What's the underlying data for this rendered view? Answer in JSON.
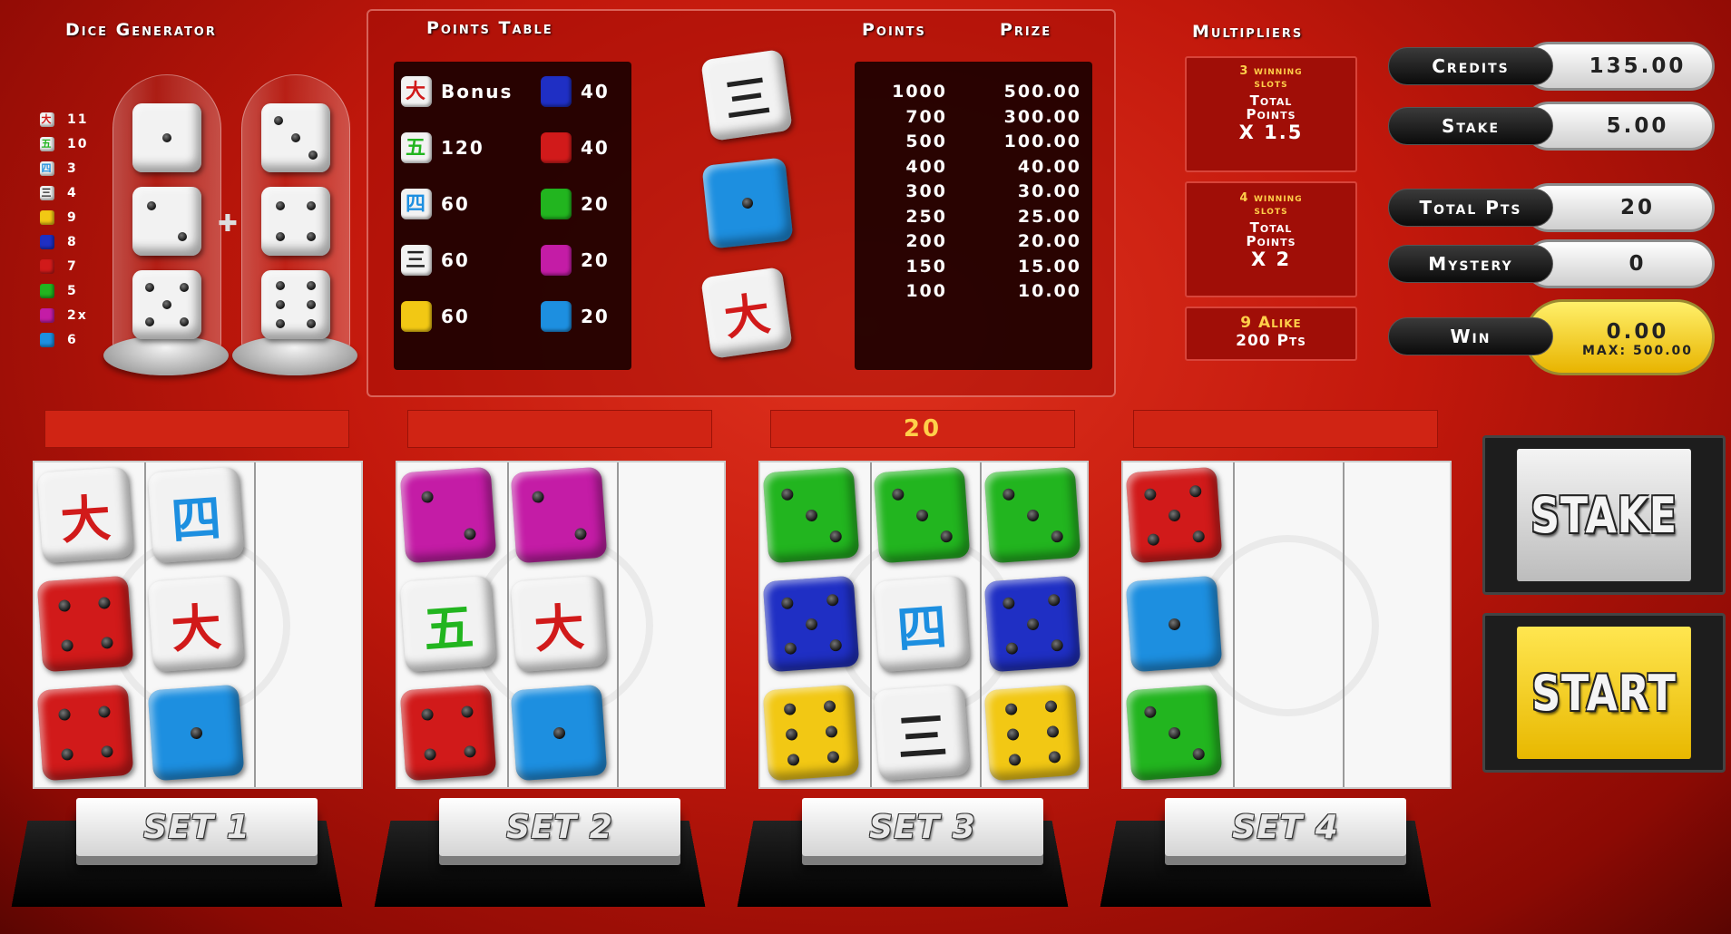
{
  "dice_generator": {
    "title": "Dice Generator",
    "legend": [
      {
        "value": "11",
        "die": "red-glyph"
      },
      {
        "value": "10",
        "die": "green-glyph"
      },
      {
        "value": "3",
        "die": "blue-glyph"
      },
      {
        "value": "4",
        "die": "black-glyph"
      },
      {
        "value": "9",
        "die": "yellow"
      },
      {
        "value": "8",
        "die": "blue"
      },
      {
        "value": "7",
        "die": "red"
      },
      {
        "value": "5",
        "die": "green"
      },
      {
        "value": "2x",
        "die": "magenta"
      },
      {
        "value": "6",
        "die": "cyan"
      }
    ],
    "plus_symbol": "✚"
  },
  "points_table": {
    "title": "Points Table",
    "left_column": [
      {
        "label": "Bonus",
        "die": "red-glyph"
      },
      {
        "label": "120",
        "die": "green-glyph"
      },
      {
        "label": "60",
        "die": "blue-glyph"
      },
      {
        "label": "60",
        "die": "black-glyph"
      },
      {
        "label": "60",
        "die": "yellow"
      }
    ],
    "right_column": [
      {
        "label": "40",
        "die": "blue"
      },
      {
        "label": "40",
        "die": "red"
      },
      {
        "label": "20",
        "die": "green"
      },
      {
        "label": "20",
        "die": "magenta"
      },
      {
        "label": "20",
        "die": "cyan"
      }
    ],
    "points_header": "Points",
    "prize_header": "Prize",
    "rows": [
      {
        "points": "1000",
        "prize": "500.00"
      },
      {
        "points": "700",
        "prize": "300.00"
      },
      {
        "points": "500",
        "prize": "100.00"
      },
      {
        "points": "400",
        "prize": "40.00"
      },
      {
        "points": "300",
        "prize": "30.00"
      },
      {
        "points": "250",
        "prize": "25.00"
      },
      {
        "points": "200",
        "prize": "20.00"
      },
      {
        "points": "150",
        "prize": "15.00"
      },
      {
        "points": "100",
        "prize": "10.00"
      }
    ]
  },
  "multipliers": {
    "title": "Multipliers",
    "box1": {
      "line1": "3 winning",
      "line2": "slots",
      "line3": "Total",
      "line4": "Points",
      "factor": "X 1.5"
    },
    "box2": {
      "line1": "4 winning",
      "line2": "slots",
      "line3": "Total",
      "line4": "Points",
      "factor": "X 2"
    },
    "box3": {
      "line1": "9 Alike",
      "line2": "200 Pts"
    }
  },
  "meters": {
    "credits": {
      "label": "Credits",
      "value": "135.00"
    },
    "stake": {
      "label": "Stake",
      "value": "5.00"
    },
    "total_pts": {
      "label": "Total Pts",
      "value": "20"
    },
    "mystery": {
      "label": "Mystery",
      "value": "0"
    },
    "win": {
      "label": "Win",
      "value": "0.00",
      "max": "MAX: 500.00"
    }
  },
  "sets": [
    {
      "label": "SET 1",
      "score": ""
    },
    {
      "label": "SET 2",
      "score": ""
    },
    {
      "label": "SET 3",
      "score": "20"
    },
    {
      "label": "SET 4",
      "score": ""
    }
  ],
  "buttons": {
    "stake": "STAKE",
    "start": "START"
  },
  "colors": {
    "red": "#d11a1a",
    "green": "#22b51f",
    "blue": "#1f2fc4",
    "cyan": "#1d8fe0",
    "magenta": "#c41ca6",
    "yellow": "#f2c814",
    "white": "#f2f2f2",
    "gold": "#ffcf4a",
    "start_button": "#ffd21c",
    "stake_button": "#d6d6d6"
  }
}
